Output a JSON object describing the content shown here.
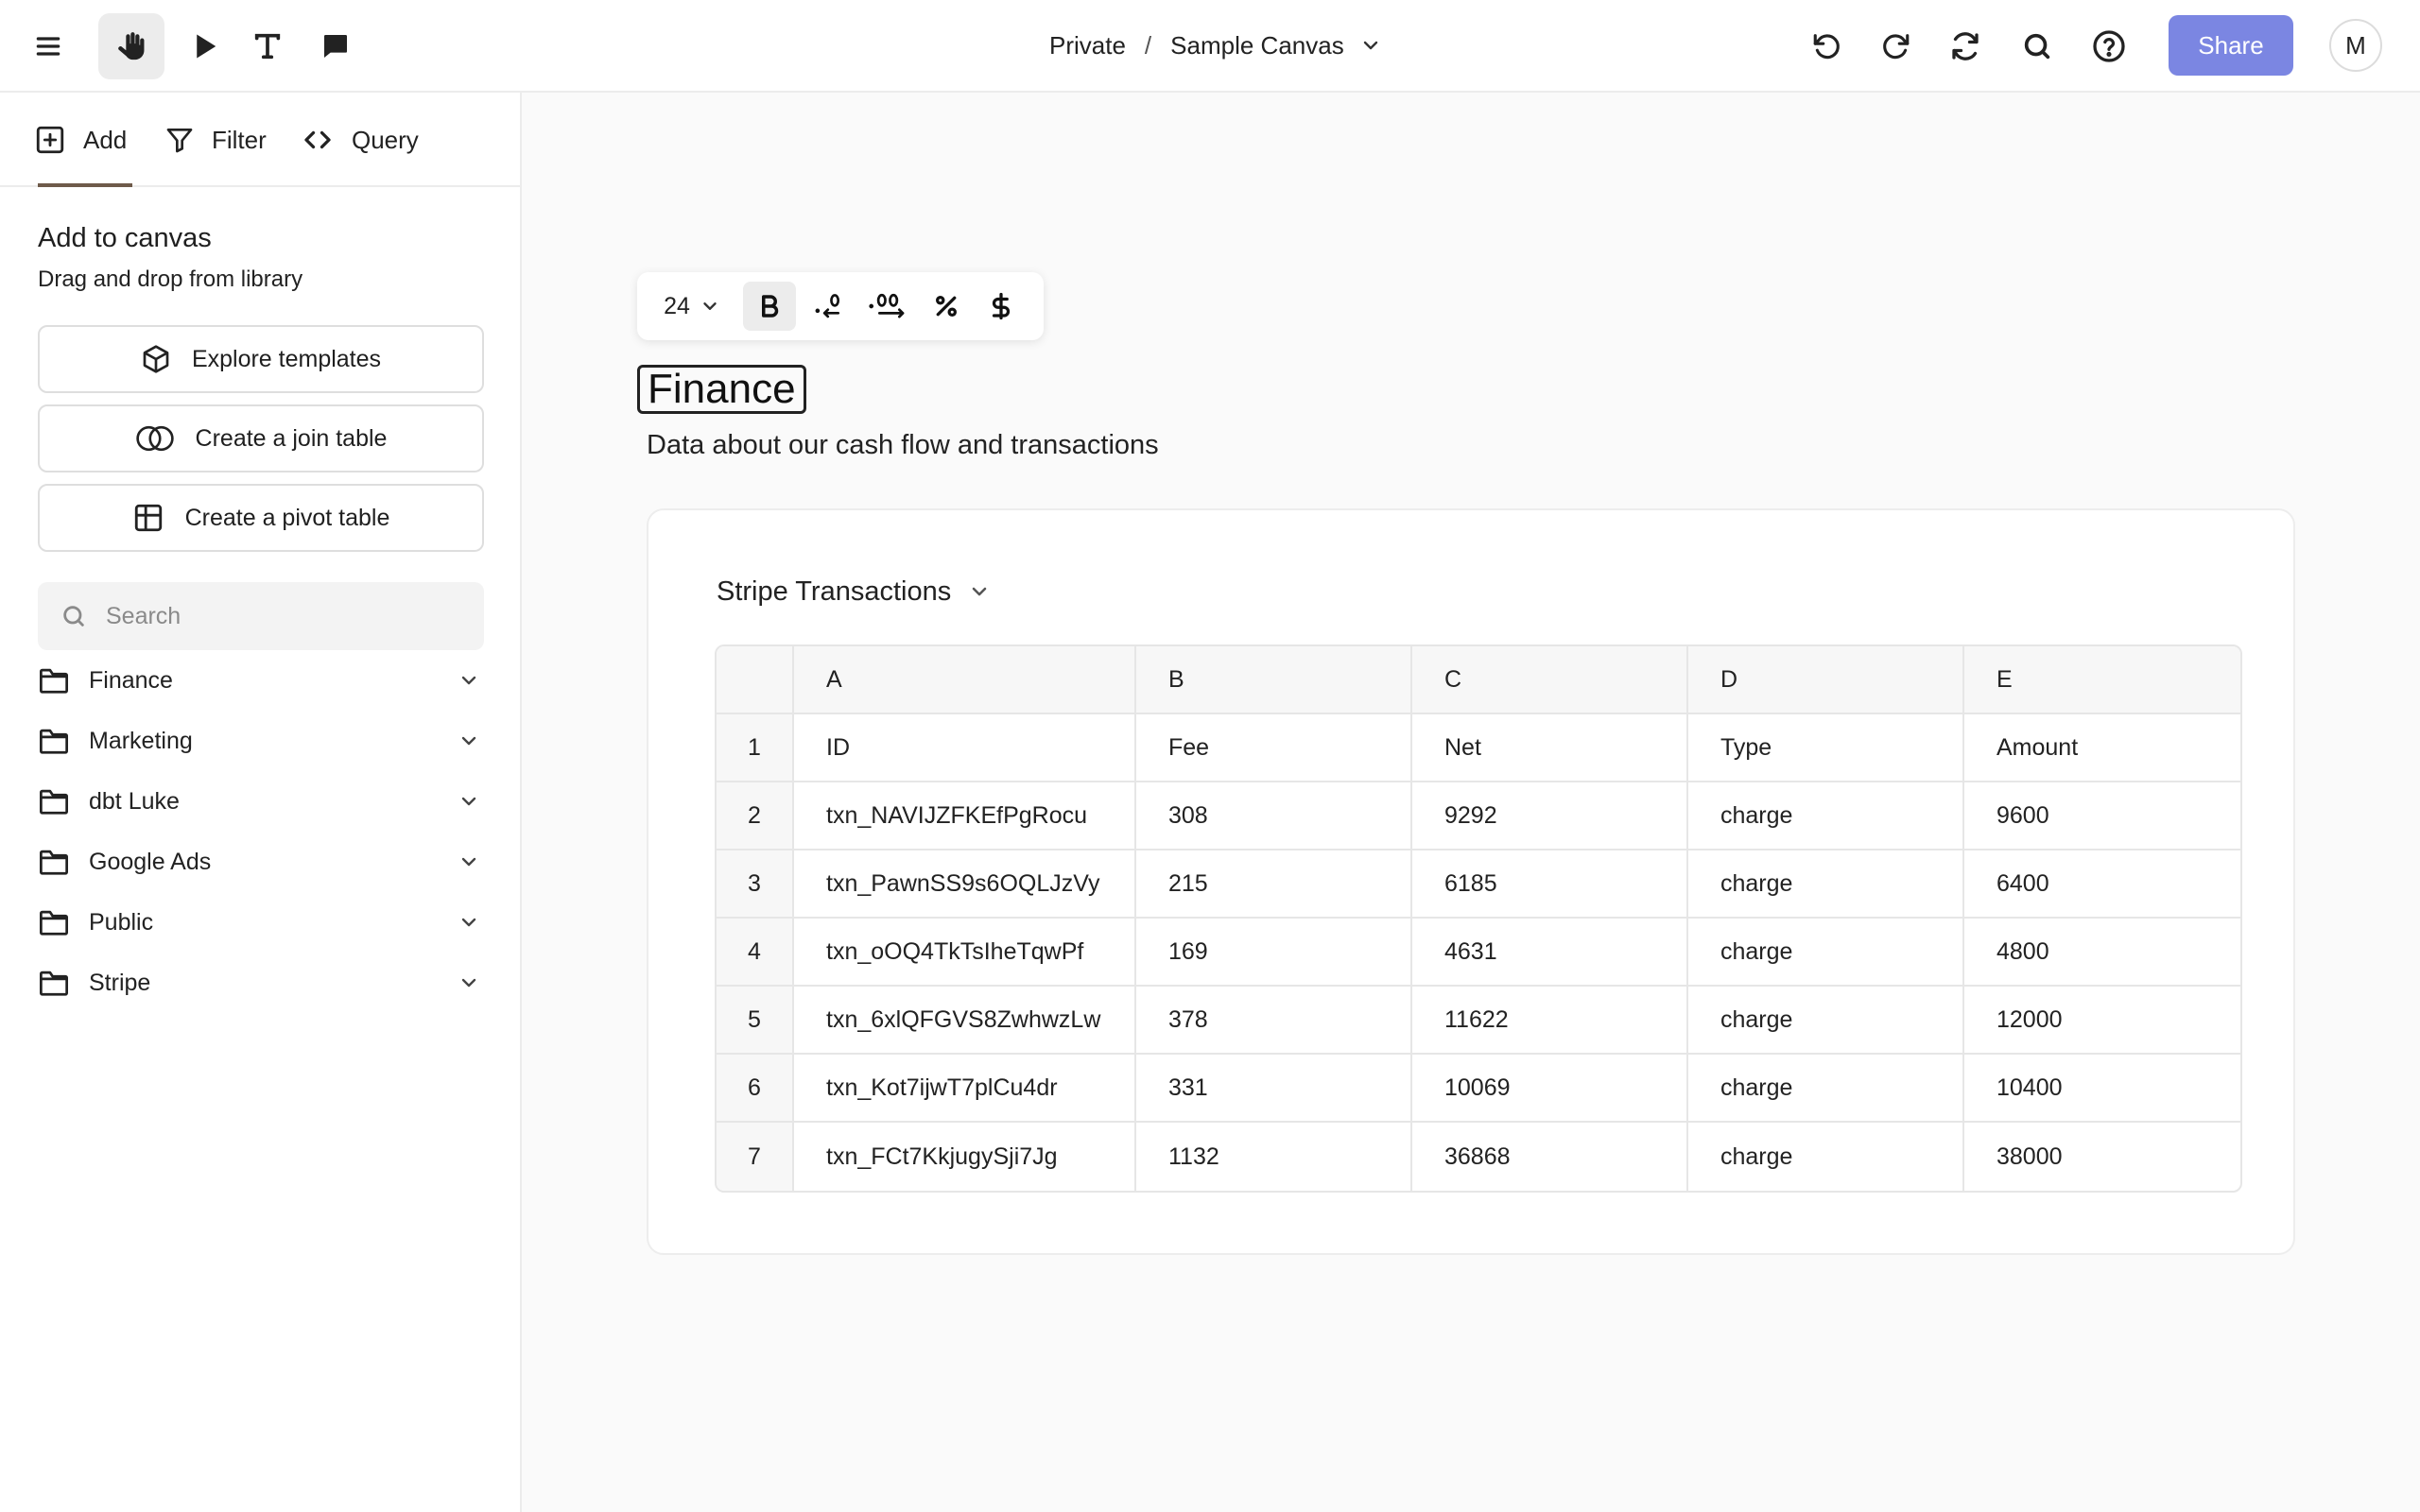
{
  "toolbar": {
    "icons": [
      "menu-icon",
      "hand-icon",
      "pointer-icon",
      "text-icon",
      "comment-icon"
    ],
    "actions": [
      "undo-icon",
      "redo-icon",
      "refresh-icon",
      "search-icon",
      "help-icon"
    ],
    "share_label": "Share",
    "avatar_initial": "M",
    "accent_color": "#7b86e2"
  },
  "breadcrumb": {
    "parent": "Private",
    "separator": "/",
    "current": "Sample Canvas"
  },
  "sidebar": {
    "tabs": [
      {
        "label": "Add",
        "icon": "plus-square-icon",
        "active": true
      },
      {
        "label": "Filter",
        "icon": "filter-icon",
        "active": false
      },
      {
        "label": "Query",
        "icon": "code-icon",
        "active": false
      }
    ],
    "title": "Add to canvas",
    "subtitle": "Drag and drop from library",
    "buttons": [
      {
        "label": "Explore templates",
        "icon": "cube-icon"
      },
      {
        "label": "Create a join table",
        "icon": "join-icon"
      },
      {
        "label": "Create a pivot table",
        "icon": "grid-icon"
      }
    ],
    "search_placeholder": "Search",
    "folders": [
      {
        "label": "Finance"
      },
      {
        "label": "Marketing"
      },
      {
        "label": "dbt Luke"
      },
      {
        "label": "Google Ads"
      },
      {
        "label": "Public"
      },
      {
        "label": "Stripe"
      }
    ]
  },
  "format_toolbar": {
    "font_size": "24"
  },
  "canvas": {
    "title": "Finance",
    "subtitle": "Data about our cash flow and transactions"
  },
  "card": {
    "title": "Stripe Transactions",
    "column_letters": [
      "A",
      "B",
      "C",
      "D",
      "E"
    ],
    "rows": [
      {
        "n": "1",
        "cells": [
          "ID",
          "Fee",
          "Net",
          "Type",
          "Amount"
        ]
      },
      {
        "n": "2",
        "cells": [
          "txn_NAVIJZFKEfPgRocu",
          "308",
          "9292",
          "charge",
          "9600"
        ]
      },
      {
        "n": "3",
        "cells": [
          "txn_PawnSS9s6OQLJzVy",
          "215",
          "6185",
          "charge",
          "6400"
        ]
      },
      {
        "n": "4",
        "cells": [
          "txn_oOQ4TkTsIheTqwPf",
          "169",
          "4631",
          "charge",
          "4800"
        ]
      },
      {
        "n": "5",
        "cells": [
          "txn_6xlQFGVS8ZwhwzLw",
          "378",
          "11622",
          "charge",
          "12000"
        ]
      },
      {
        "n": "6",
        "cells": [
          "txn_Kot7ijwT7plCu4dr",
          "331",
          "10069",
          "charge",
          "10400"
        ]
      },
      {
        "n": "7",
        "cells": [
          "txn_FCt7KkjugySji7Jg",
          "1132",
          "36868",
          "charge",
          "38000"
        ]
      }
    ]
  }
}
